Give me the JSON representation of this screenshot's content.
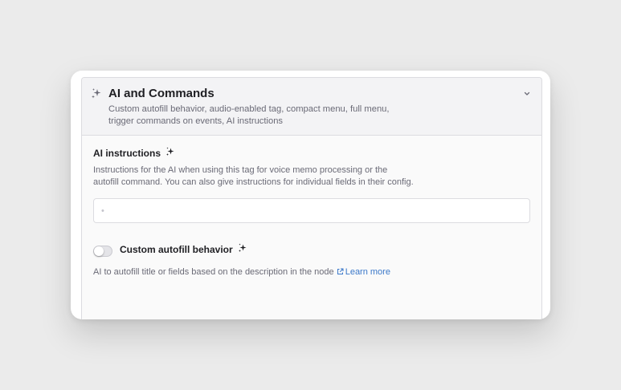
{
  "section": {
    "title": "AI and Commands",
    "subtitle": "Custom autofill behavior, audio-enabled tag, compact menu, full menu, trigger commands on events, AI instructions",
    "header_icon": "sparkle-icon",
    "collapse_icon": "chevron-down-icon"
  },
  "ai_instructions": {
    "label": "AI instructions",
    "description": "Instructions for the AI when using this tag for voice memo processing or the autofill command. You can also give instructions for individual fields in their config.",
    "value": "",
    "placeholder": "•"
  },
  "custom_autofill": {
    "label": "Custom autofill behavior",
    "enabled": false,
    "description": "AI to autofill title or fields based on the description in the node",
    "link_label": "Learn more",
    "link_icon": "external-link-icon"
  },
  "colors": {
    "background": "#ebebeb",
    "link": "#3b78c9",
    "muted_text": "#6a6a76"
  }
}
